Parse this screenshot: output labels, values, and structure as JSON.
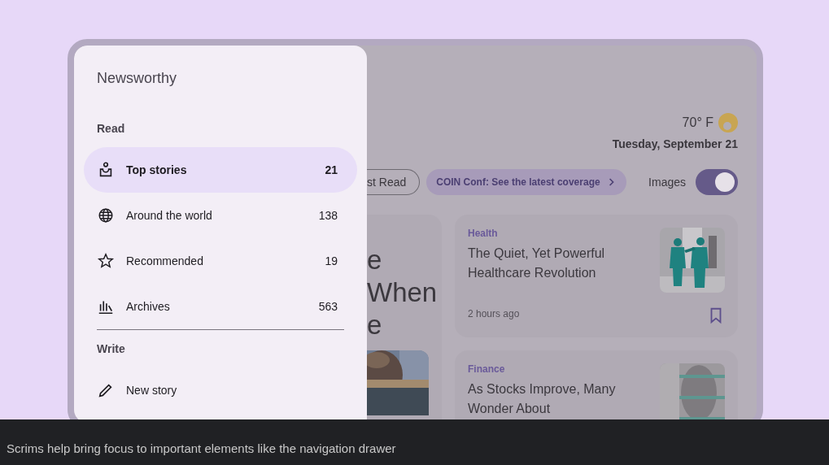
{
  "drawer": {
    "title": "Newsworthy",
    "sections": [
      {
        "label": "Read",
        "items": [
          {
            "label": "Top stories",
            "count": "21",
            "selected": true
          },
          {
            "label": "Around the world",
            "count": "138",
            "selected": false
          },
          {
            "label": "Recommended",
            "count": "19",
            "selected": false
          },
          {
            "label": "Archives",
            "count": "563",
            "selected": false
          }
        ]
      },
      {
        "label": "Write",
        "items": [
          {
            "label": "New story",
            "selected": false
          }
        ]
      }
    ]
  },
  "weather": {
    "temperature": "70° F",
    "date": "Tuesday, September 21"
  },
  "chips": [
    {
      "kind": "outline",
      "label": "st Read"
    },
    {
      "kind": "filled",
      "label": "COIN Conf: See the latest coverage"
    }
  ],
  "images_toggle": {
    "label": "Images",
    "on": true
  },
  "lead_story": {
    "headline_lines": [
      "e",
      "When",
      "e"
    ]
  },
  "stories": [
    {
      "category": "Health",
      "title": "The Quiet, Yet Powerful Healthcare Revolution",
      "time": "2 hours ago"
    },
    {
      "category": "Finance",
      "title": "As Stocks Improve, Many Wonder About"
    }
  ],
  "caption": "Scrims help bring focus to important elements like the navigation drawer"
}
